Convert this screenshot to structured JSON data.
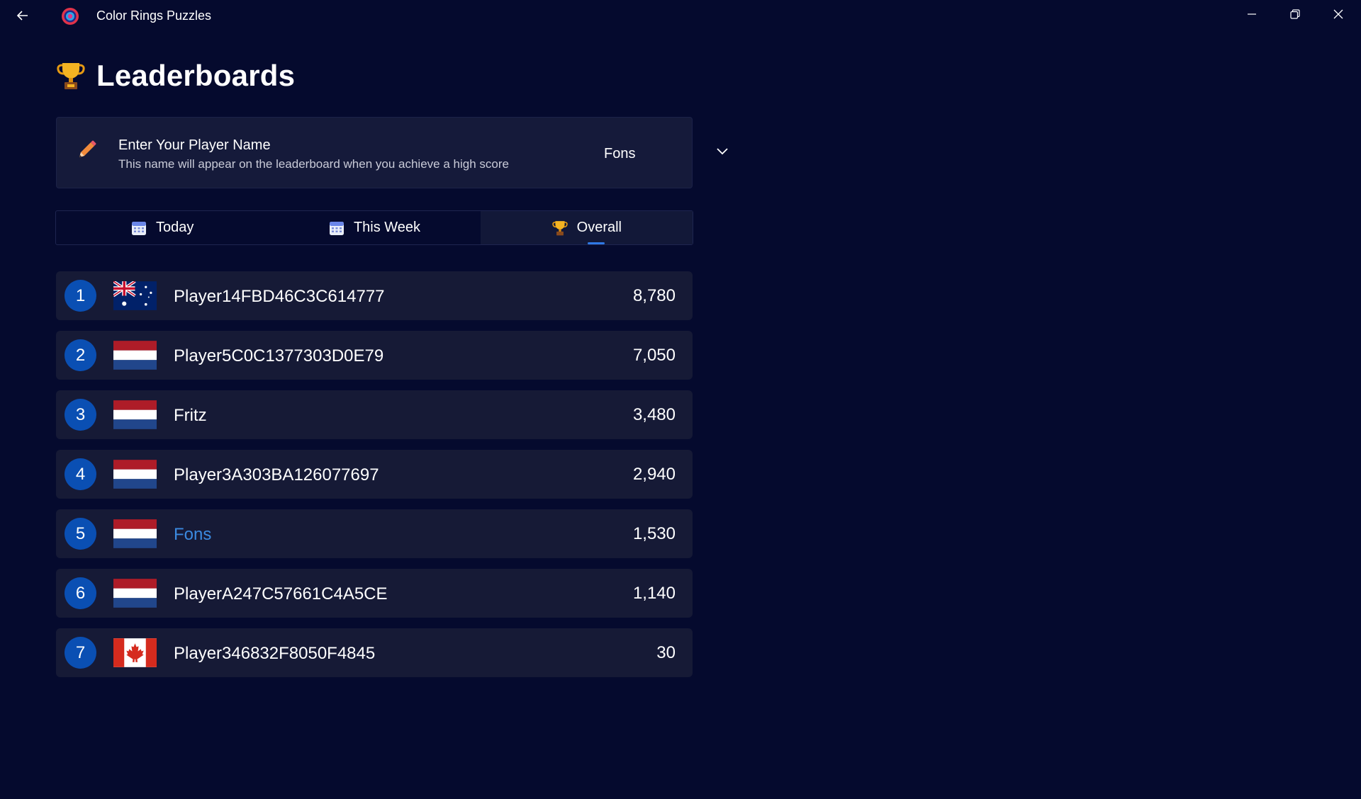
{
  "app": {
    "title": "Color Rings Puzzles"
  },
  "page": {
    "heading": "Leaderboards"
  },
  "player_name_card": {
    "title": "Enter Your Player Name",
    "description": "This name will appear on the leaderboard when you achieve a high score",
    "selected_name": "Fons"
  },
  "tabs": [
    {
      "label": "Today",
      "icon": "calendar-icon",
      "active": false
    },
    {
      "label": "This Week",
      "icon": "calendar-icon",
      "active": false
    },
    {
      "label": "Overall",
      "icon": "trophy-icon",
      "active": true
    }
  ],
  "leaderboard": [
    {
      "rank": "1",
      "country": "Australia",
      "flag": "australia-flag-icon",
      "name": "Player14FBD46C3C614777",
      "score": "8,780",
      "is_current_player": false
    },
    {
      "rank": "2",
      "country": "Netherlands",
      "flag": "netherlands-flag-icon",
      "name": "Player5C0C1377303D0E79",
      "score": "7,050",
      "is_current_player": false
    },
    {
      "rank": "3",
      "country": "Netherlands",
      "flag": "netherlands-flag-icon",
      "name": "Fritz",
      "score": "3,480",
      "is_current_player": false
    },
    {
      "rank": "4",
      "country": "Netherlands",
      "flag": "netherlands-flag-icon",
      "name": "Player3A303BA126077697",
      "score": "2,940",
      "is_current_player": false
    },
    {
      "rank": "5",
      "country": "Netherlands",
      "flag": "netherlands-flag-icon",
      "name": "Fons",
      "score": "1,530",
      "is_current_player": true
    },
    {
      "rank": "6",
      "country": "Netherlands",
      "flag": "netherlands-flag-icon",
      "name": "PlayerA247C57661C4A5CE",
      "score": "1,140",
      "is_current_player": false
    },
    {
      "rank": "7",
      "country": "Canada",
      "flag": "canada-flag-icon",
      "name": "Player346832F8050F4845",
      "score": "30",
      "is_current_player": false
    }
  ],
  "colors": {
    "background": "#050a2e",
    "card": "#161a36",
    "accent": "#2f79e6",
    "rank_badge": "#0a4fb3",
    "current_player_text": "#3b8ae0"
  }
}
